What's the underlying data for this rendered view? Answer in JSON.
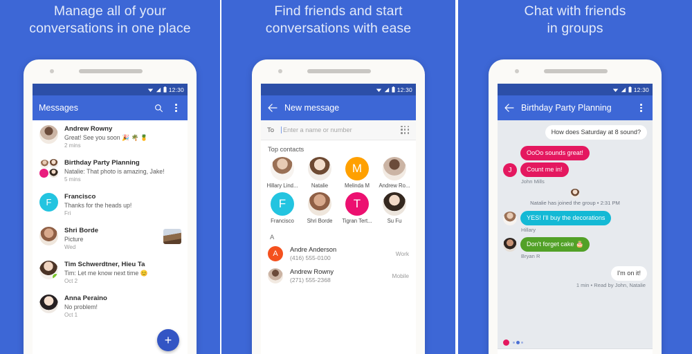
{
  "panels": [
    {
      "headline": "Manage all of your\nconversations in one place",
      "headline_line1": "Manage all of your",
      "headline_line2": "conversations in one place",
      "status": {
        "time": "12:30"
      },
      "appbar": {
        "title": "Messages",
        "search_icon": "search-icon",
        "overflow_icon": "more-vertical-icon"
      },
      "fab_label": "+",
      "conversations": [
        {
          "name": "Andrew Rowny",
          "snippet": "Great! See you soon 🎉 🌴 🍍",
          "time": "2 mins",
          "avatar_type": "photo",
          "avatar_class": "ph-a",
          "thumb": false
        },
        {
          "name": "Birthday Party Planning",
          "snippet": "Natalie: That photo is amazing, Jake!",
          "time": "5 mins",
          "avatar_type": "group",
          "thumb": false
        },
        {
          "name": "Francisco",
          "snippet": "Thanks for the heads up!",
          "time": "Fri",
          "avatar_type": "initial",
          "initial": "F",
          "color": "#23c4e0",
          "thumb": false
        },
        {
          "name": "Shri Borde",
          "snippet": "Picture",
          "time": "Wed",
          "avatar_type": "photo",
          "avatar_class": "ph-b",
          "thumb": true
        },
        {
          "name": "Tim Schwerdtner, Hieu Ta",
          "snippet": "Tim: Let me know next time 😊",
          "time": "Oct 2",
          "avatar_type": "photo",
          "avatar_class": "ph-c",
          "badge_color": "#7bc62d",
          "thumb": false
        },
        {
          "name": "Anna Peraino",
          "snippet": "No problem!",
          "time": "Oct 1",
          "avatar_type": "photo",
          "avatar_class": "ph-g",
          "thumb": false
        }
      ]
    },
    {
      "headline_line1": "Find friends and start",
      "headline_line2": "conversations with ease",
      "status": {
        "time": "12:30"
      },
      "appbar": {
        "title": "New message",
        "back_icon": "arrow-left-icon"
      },
      "to_field": {
        "label": "To",
        "placeholder": "Enter a name or number",
        "dialpad_icon": "dialpad-icon"
      },
      "top_contacts_label": "Top contacts",
      "top_contacts": [
        {
          "name": "Hillary Lind...",
          "type": "photo",
          "avatar_class": "ph-h"
        },
        {
          "name": "Natalie",
          "type": "photo",
          "avatar_class": "ph-e"
        },
        {
          "name": "Melinda M",
          "type": "initial",
          "initial": "M",
          "color": "#ffa000"
        },
        {
          "name": "Andrew Ro...",
          "type": "photo",
          "avatar_class": "ph-a"
        },
        {
          "name": "Francisco",
          "type": "initial",
          "initial": "F",
          "color": "#23c4e0"
        },
        {
          "name": "Shri Borde",
          "type": "photo",
          "avatar_class": "ph-b"
        },
        {
          "name": "Tigran Tert...",
          "type": "initial",
          "initial": "T",
          "color": "#ec1070"
        },
        {
          "name": "Su Fu",
          "type": "photo",
          "avatar_class": "ph-i"
        }
      ],
      "alpha_header": "A",
      "contacts": [
        {
          "name": "Andre Anderson",
          "number": "(416) 555-0100",
          "type": "Work",
          "avatar_type": "initial",
          "initial": "A",
          "color": "#f4511e"
        },
        {
          "name": "Andrew Rowny",
          "number": "(271) 555-2368",
          "type": "Mobile",
          "avatar_type": "photo",
          "avatar_class": "ph-a"
        }
      ]
    },
    {
      "headline_line1": "Chat with friends",
      "headline_line2": "in groups",
      "status": {
        "time": "12:30"
      },
      "appbar": {
        "title": "Birthday Party Planning",
        "back_icon": "arrow-left-icon",
        "overflow_icon": "more-vertical-icon"
      },
      "messages": [
        {
          "text": "How does Saturday at 8 sound?",
          "side": "right",
          "style": "white"
        },
        {
          "text": "OoOo sounds great!",
          "side": "left",
          "style": "pink",
          "avatar": "none"
        },
        {
          "text": "Count me in!",
          "side": "left",
          "style": "pink",
          "avatar_type": "initial",
          "initial": "J",
          "color": "#e4185f",
          "sender": "John Mills"
        },
        {
          "text": "Natalie has joined the group • 2:31 PM",
          "side": "system",
          "avatar_class": "ph-e"
        },
        {
          "text": "YES! I'll buy the decorations",
          "side": "left",
          "style": "teal",
          "avatar_type": "photo",
          "avatar_class": "ph-h",
          "sender": "Hillary"
        },
        {
          "text": "Don't forget cake 🎂",
          "side": "left",
          "style": "green",
          "avatar_type": "photo",
          "avatar_class": "ph-f",
          "sender": "Bryan R"
        },
        {
          "text": "I'm on it!",
          "side": "right",
          "style": "white",
          "sender": "1 min • Read by John, Natalie"
        }
      ],
      "typing_indicator": "typing-indicator"
    }
  ]
}
